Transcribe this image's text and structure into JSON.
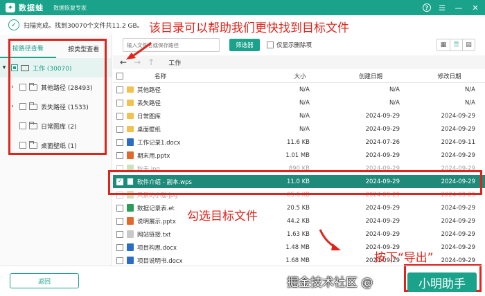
{
  "app": {
    "logo_text": "数据蛙",
    "tagline": "数据恢复专家"
  },
  "status": {
    "text": "扫描完成。找到30070个文件共11.2 GB。"
  },
  "annotations": {
    "top": "该目录可以帮助我们更快找到目标文件",
    "middle": "勾选目标文件",
    "bottom": "按下“导出”"
  },
  "left": {
    "tabs": [
      "按路径查看",
      "按类型查看"
    ],
    "tree": [
      {
        "label": "工作 (30070)"
      },
      {
        "label": "其他路径 (28493)"
      },
      {
        "label": "丢失路径 (1533)"
      },
      {
        "label": "日常图库 (2)"
      },
      {
        "label": "桌面壁纸 (1)"
      }
    ]
  },
  "toolbar": {
    "search_placeholder": "输入文件名或保存路径",
    "filter_label": "筛选器",
    "deleted_only_label": "仅显示删除项"
  },
  "nav": {
    "breadcrumb": "工作"
  },
  "table": {
    "headers": {
      "name": "名称",
      "size": "大小",
      "created": "创建日期",
      "modified": "修改日期"
    },
    "rows": [
      {
        "name": "其他路径",
        "size": "N/A",
        "created": "N/A",
        "modified": "N/A",
        "type": "folder"
      },
      {
        "name": "丢失路径",
        "size": "N/A",
        "created": "N/A",
        "modified": "N/A",
        "type": "folder"
      },
      {
        "name": "日常图库",
        "size": "N/A",
        "created": "2024-09-29",
        "modified": "2024-09-29",
        "type": "folder"
      },
      {
        "name": "桌面壁纸",
        "size": "N/A",
        "created": "2024-09-29",
        "modified": "2024-09-29",
        "type": "folder"
      },
      {
        "name": "工作记录1.docx",
        "size": "11.6 KB",
        "created": "2024-07-26",
        "modified": "2024-09-11",
        "type": "docx"
      },
      {
        "name": "期末用.pptx",
        "size": "1.01 MB",
        "created": "2024-09-29",
        "modified": "2024-09-29",
        "type": "pptx"
      },
      {
        "name": "秋天.jpg",
        "size": "890 KB",
        "created": "2024-09-29",
        "modified": "2024-09-29",
        "type": "jpg"
      },
      {
        "name": "软件介绍 - 副本.wps",
        "size": "11.0 KB",
        "created": "2024-09-29",
        "modified": "2024-09-29",
        "type": "wps"
      },
      {
        "name": "风景的小猫.jpg",
        "size": "85.6 KB",
        "created": "2024-09-29",
        "modified": "2024-09-29",
        "type": "jpg"
      },
      {
        "name": "数据记录表.et",
        "size": "20.5 KB",
        "created": "2024-09-29",
        "modified": "2024-09-29",
        "type": "et"
      },
      {
        "name": "说明展示.pptx",
        "size": "44.2 KB",
        "created": "2024-09-29",
        "modified": "2024-09-29",
        "type": "pptx"
      },
      {
        "name": "网站链接.txt",
        "size": "1.63 KB",
        "created": "2024-09-29",
        "modified": "2024-09-29",
        "type": "txt"
      },
      {
        "name": "项目构思.docx",
        "size": "1.48 MB",
        "created": "2024-09-29",
        "modified": "2024-09-29",
        "type": "docx"
      },
      {
        "name": "项目说明书.docx",
        "size": "1.68 MB",
        "created": "2024-09-29",
        "modified": "2024-09-29",
        "type": "docx"
      }
    ]
  },
  "bottom": {
    "back_label": "返回",
    "export_label": "小明助手",
    "watermark": "掘金技术社区 @"
  }
}
